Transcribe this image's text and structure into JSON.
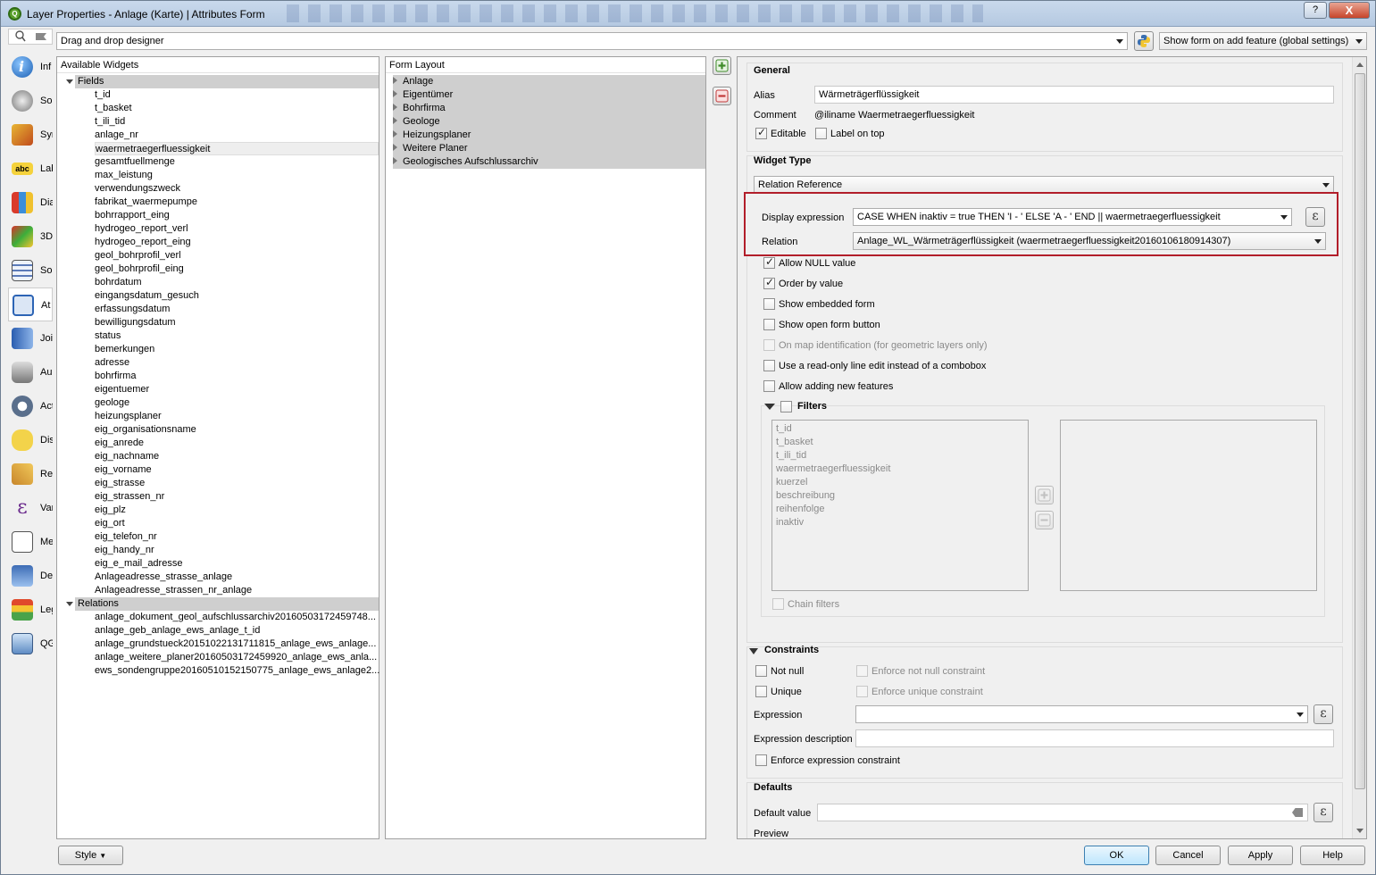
{
  "window": {
    "title": "Layer Properties - Anlage (Karte) | Attributes Form",
    "help": "?",
    "close": "X"
  },
  "top": {
    "designer_mode": "Drag and drop designer",
    "show_form": "Show form on add feature (global settings)"
  },
  "sidebar": {
    "items": [
      {
        "icon": "info-icon",
        "label": "Inf"
      },
      {
        "icon": "source-icon",
        "label": "Sou"
      },
      {
        "icon": "symbology-icon",
        "label": "Sym"
      },
      {
        "icon": "labels-icon",
        "label": "Lab"
      },
      {
        "icon": "diagrams-icon",
        "label": "Dia"
      },
      {
        "icon": "3d-view-icon",
        "label": "3D"
      },
      {
        "icon": "source-fields-icon",
        "label": "Sou"
      },
      {
        "icon": "attributes-form-icon",
        "label": "At"
      },
      {
        "icon": "joins-icon",
        "label": "Joi"
      },
      {
        "icon": "auxiliary-storage-icon",
        "label": "Au"
      },
      {
        "icon": "actions-icon",
        "label": "Act"
      },
      {
        "icon": "display-icon",
        "label": "Dis"
      },
      {
        "icon": "rendering-icon",
        "label": "Re"
      },
      {
        "icon": "variables-icon",
        "label": "Var"
      },
      {
        "icon": "metadata-icon",
        "label": "Me"
      },
      {
        "icon": "dependencies-icon",
        "label": "De"
      },
      {
        "icon": "legend-icon",
        "label": "Leg"
      },
      {
        "icon": "qgis-server-icon",
        "label": "QG"
      }
    ]
  },
  "widgets": {
    "header": "Available Widgets",
    "fields_label": "Fields",
    "fields": [
      "t_id",
      "t_basket",
      "t_ili_tid",
      "anlage_nr",
      "waermetraegerfluessigkeit",
      "gesamtfuellmenge",
      "max_leistung",
      "verwendungszweck",
      "fabrikat_waermepumpe",
      "bohrrapport_eing",
      "hydrogeo_report_verl",
      "hydrogeo_report_eing",
      "geol_bohrprofil_verl",
      "geol_bohrprofil_eing",
      "bohrdatum",
      "eingangsdatum_gesuch",
      "erfassungsdatum",
      "bewilligungsdatum",
      "status",
      "bemerkungen",
      "adresse",
      "bohrfirma",
      "eigentuemer",
      "geologe",
      "heizungsplaner",
      "eig_organisationsname",
      "eig_anrede",
      "eig_nachname",
      "eig_vorname",
      "eig_strasse",
      "eig_strassen_nr",
      "eig_plz",
      "eig_ort",
      "eig_telefon_nr",
      "eig_handy_nr",
      "eig_e_mail_adresse",
      "Anlageadresse_strasse_anlage",
      "Anlageadresse_strassen_nr_anlage"
    ],
    "relations_label": "Relations",
    "relations": [
      "anlage_dokument_geol_aufschlussarchiv20160503172459748...",
      "anlage_geb_anlage_ews_anlage_t_id",
      "anlage_grundstueck20151022131711815_anlage_ews_anlage...",
      "anlage_weitere_planer20160503172459920_anlage_ews_anla...",
      "ews_sondengruppe20160510152150775_anlage_ews_anlage2..."
    ]
  },
  "form_layout": {
    "header": "Form Layout",
    "items": [
      "Anlage",
      "Eigentümer",
      "Bohrfirma",
      "Geologe",
      "Heizungsplaner",
      "Weitere Planer",
      "Geologisches Aufschlussarchiv"
    ]
  },
  "general": {
    "title": "General",
    "alias_label": "Alias",
    "alias_value": "Wärmeträgerflüssigkeit",
    "comment_label": "Comment",
    "comment_value": "@iliname Waermetraegerfluessigkeit",
    "editable": "Editable",
    "label_on_top": "Label on top"
  },
  "widget_type": {
    "title": "Widget Type",
    "type": "Relation Reference",
    "display_expression_label": "Display expression",
    "display_expression": "CASE WHEN inaktiv = true THEN 'I - ' ELSE 'A - ' END || waermetraegerfluessigkeit",
    "relation_label": "Relation",
    "relation": "Anlage_WL_Wärmeträgerflüssigkeit (waermetraegerfluessigkeit20160106180914307)",
    "options": {
      "allow_null": "Allow NULL value",
      "order_by_value": "Order by value",
      "show_embedded_form": "Show embedded form",
      "show_open_form": "Show open form button",
      "on_map_identification": "On map identification (for geometric layers only)",
      "read_only_line_edit": "Use a read-only line edit instead of a combobox",
      "allow_adding": "Allow adding new features"
    },
    "filters_label": "Filters",
    "filter_fields": [
      "t_id",
      "t_basket",
      "t_ili_tid",
      "waermetraegerfluessigkeit",
      "kuerzel",
      "beschreibung",
      "reihenfolge",
      "inaktiv"
    ],
    "chain_filters": "Chain filters"
  },
  "constraints": {
    "title": "Constraints",
    "not_null": "Not null",
    "enforce_not_null": "Enforce not null constraint",
    "unique": "Unique",
    "enforce_unique": "Enforce unique constraint",
    "expression_label": "Expression",
    "expression_description_label": "Expression description",
    "enforce_expression": "Enforce expression constraint"
  },
  "defaults": {
    "title": "Defaults",
    "default_value_label": "Default value",
    "preview_label": "Preview"
  },
  "buttons": {
    "style": "Style",
    "ok": "OK",
    "cancel": "Cancel",
    "apply": "Apply",
    "help": "Help"
  },
  "colors": {
    "highlight_border": "#b21e2a",
    "group_row": "#cfcfcf"
  }
}
